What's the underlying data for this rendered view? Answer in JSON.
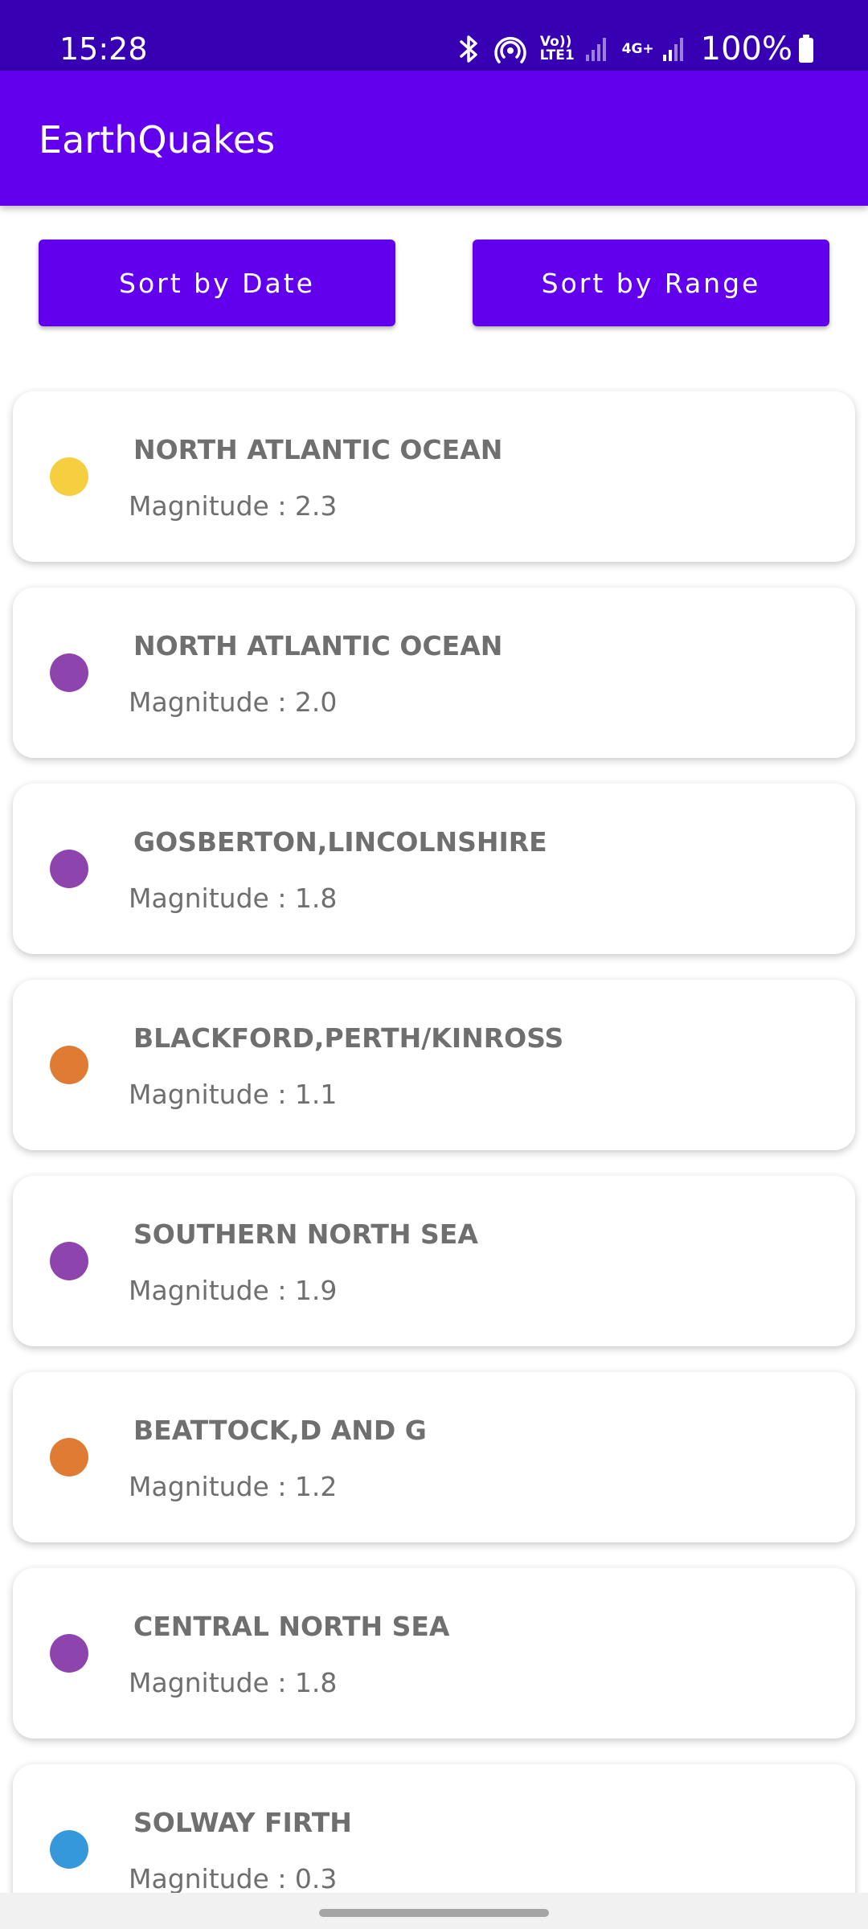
{
  "status_bar": {
    "time": "15:28",
    "network_label_1": "Vo)) LTE1",
    "network_label_2": "4G+",
    "battery_percent": "100%",
    "icons": [
      "bluetooth-icon",
      "hotspot-icon",
      "signal-icon",
      "signal-icon",
      "battery-icon"
    ]
  },
  "app_bar": {
    "title": "EarthQuakes"
  },
  "buttons": {
    "sort_date": "Sort by Date",
    "sort_range": "Sort by Range"
  },
  "colors": {
    "status_bar": "#3700b3",
    "primary": "#6200ee",
    "magnitude_yellow": "#f5cf3f",
    "magnitude_purple": "#8e44ad",
    "magnitude_orange": "#e07b34",
    "magnitude_blue": "#3498db"
  },
  "earthquakes": [
    {
      "location": "NORTH ATLANTIC OCEAN",
      "magnitude": "Magnitude : 2.3",
      "color": "#f5cf3f"
    },
    {
      "location": "NORTH ATLANTIC OCEAN",
      "magnitude": "Magnitude : 2.0",
      "color": "#8e44ad"
    },
    {
      "location": "GOSBERTON,LINCOLNSHIRE",
      "magnitude": "Magnitude : 1.8",
      "color": "#8e44ad"
    },
    {
      "location": "BLACKFORD,PERTH/KINROSS",
      "magnitude": "Magnitude : 1.1",
      "color": "#e07b34"
    },
    {
      "location": "SOUTHERN NORTH SEA",
      "magnitude": "Magnitude : 1.9",
      "color": "#8e44ad"
    },
    {
      "location": "BEATTOCK,D AND G",
      "magnitude": "Magnitude : 1.2",
      "color": "#e07b34"
    },
    {
      "location": "CENTRAL NORTH SEA",
      "magnitude": "Magnitude : 1.8",
      "color": "#8e44ad"
    },
    {
      "location": "SOLWAY FIRTH",
      "magnitude": "Magnitude : 0.3",
      "color": "#3498db"
    }
  ]
}
